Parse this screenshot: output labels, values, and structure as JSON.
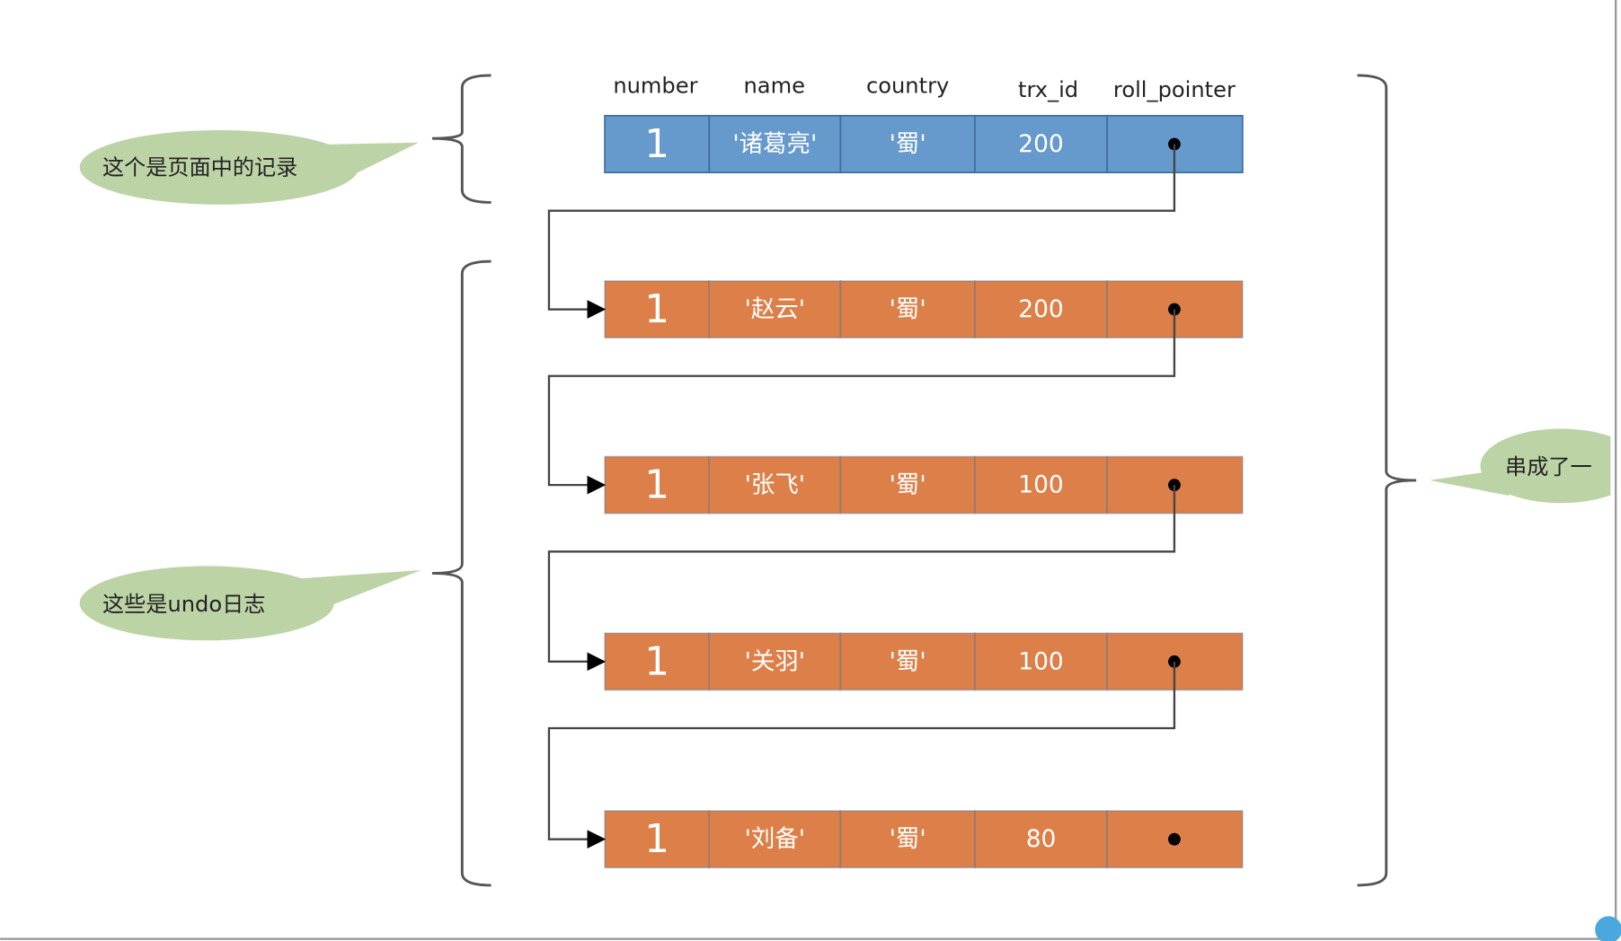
{
  "columns": [
    "number",
    "name",
    "country",
    "trx_id",
    "roll_pointer"
  ],
  "colors": {
    "current_record": "#6699cc",
    "undo_record": "#dd7f48",
    "bubble": "#bcd3a6"
  },
  "records": [
    {
      "kind": "current",
      "number": "1",
      "name": "'诸葛亮'",
      "country": "'蜀'",
      "trx_id": "200"
    },
    {
      "kind": "undo",
      "number": "1",
      "name": "'赵云'",
      "country": "'蜀'",
      "trx_id": "200"
    },
    {
      "kind": "undo",
      "number": "1",
      "name": "'张飞'",
      "country": "'蜀'",
      "trx_id": "100"
    },
    {
      "kind": "undo",
      "number": "1",
      "name": "'关羽'",
      "country": "'蜀'",
      "trx_id": "100"
    },
    {
      "kind": "undo",
      "number": "1",
      "name": "'刘备'",
      "country": "'蜀'",
      "trx_id": "80"
    }
  ],
  "callouts": {
    "page_record": "这个是页面中的记录",
    "undo_log": "这些是undo日志",
    "chain": "串成了一"
  }
}
